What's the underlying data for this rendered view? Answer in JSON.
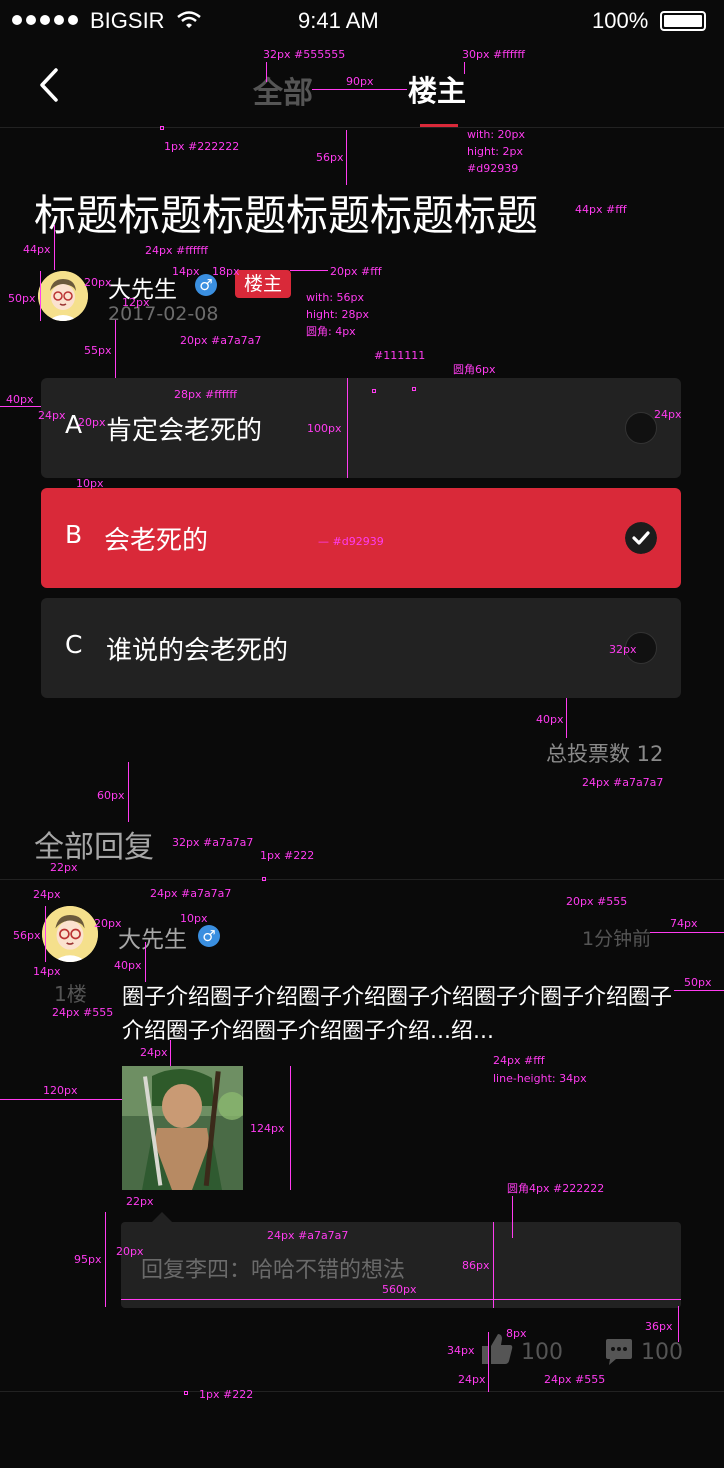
{
  "status_bar": {
    "carrier": "BIGSIR",
    "time": "9:41 AM",
    "battery": "100%"
  },
  "nav": {
    "tab_all": "全部",
    "tab_owner": "楼主",
    "indicator_color": "#d92939"
  },
  "post": {
    "title": "标题标题标题标题标题标题",
    "author": "大先生",
    "gender": "♂",
    "owner_badge": "楼主",
    "date": "2017-02-08"
  },
  "options": [
    {
      "letter": "A",
      "text": "肯定会老死的",
      "selected": false
    },
    {
      "letter": "B",
      "text": "会老死的",
      "selected": true
    },
    {
      "letter": "C",
      "text": "谁说的会老死的",
      "selected": false
    }
  ],
  "vote_total": "总投票数 12",
  "replies_header": "全部回复",
  "reply": {
    "author": "大先生",
    "gender": "♂",
    "floor": "1楼",
    "time": "1分钟前",
    "content": "圈子介绍圈子介绍圈子介绍圈子介绍圈子介圈子介绍圈子介绍圈子介绍圈子介绍圈子介绍...绍...",
    "quote": "回复李四：哈哈不错的想法",
    "likes": "100",
    "comments": "100"
  },
  "colors": {
    "accent": "#d92939",
    "muted": "#a7a7a7",
    "card": "#222222",
    "annotation": "#ff3cf0"
  },
  "annotations": {
    "a1": "32px #555555",
    "a2": "30px #ffffff",
    "a3": "90px",
    "a4": "1px #222222",
    "a5": "with: 20px",
    "a6": "hight: 2px",
    "a7": "#d92939",
    "a8": "56px",
    "a9": "44px #fff",
    "a10": "44px",
    "a11": "24px #ffffff",
    "a12": "20px",
    "a13": "14px",
    "a14": "18px",
    "a15": "20px #fff",
    "a16": "50px",
    "a17": "12px",
    "a18": "with: 56px",
    "a19": "hight: 28px",
    "a20": "圆角: 4px",
    "a21": "20px #a7a7a7",
    "a22": "55px",
    "a23": "#111111",
    "a24": "圆角6px",
    "a25": "40px",
    "a26": "28px #ffffff",
    "a27": "24px",
    "a28": "20px",
    "a29": "100px",
    "a30": "24px",
    "a31": "10px",
    "a32": "32px",
    "a33": "40px",
    "a34": "24px #a7a7a7",
    "a35": "60px",
    "a36": "32px #a7a7a7",
    "a37": "1px #222",
    "a38": "22px",
    "a39": "24px",
    "a40": "24px #a7a7a7",
    "a41": "20px #555",
    "a42": "56px",
    "a43": "20px",
    "a44": "10px",
    "a45": "74px",
    "a46": "14px",
    "a47": "40px",
    "a48": "50px",
    "a49": "24px #555",
    "a50": "24px",
    "a51": "24px #fff",
    "a52": "line-height: 34px",
    "a53": "120px",
    "a54": "124px",
    "a55": "圆角4px #222222",
    "a56": "22px",
    "a57": "24px #a7a7a7",
    "a58": "95px",
    "a59": "20px",
    "a60": "86px",
    "a61": "560px",
    "a62": "36px",
    "a63": "8px",
    "a64": "34px",
    "a65": "24px",
    "a66": "24px #555",
    "a67": "1px #222",
    "a68": "— #d92939"
  }
}
